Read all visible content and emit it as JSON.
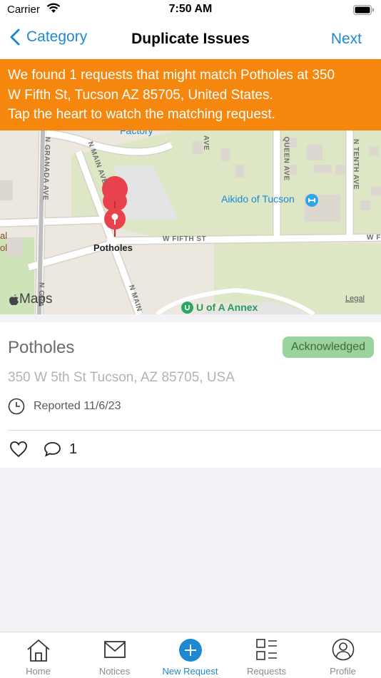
{
  "status_bar": {
    "carrier": "Carrier",
    "time": "7:50 AM"
  },
  "nav": {
    "back_label": "Category",
    "title": "Duplicate Issues",
    "next_label": "Next"
  },
  "banner": {
    "lines": [
      "We found 1 requests that might match Potholes at 350",
      "W Fifth St, Tucson AZ 85705, United States.",
      "Tap the heart to watch the matching request."
    ]
  },
  "map": {
    "streets": {
      "granada": "N GRANADA AVE",
      "granada_lower": "N GRA",
      "main": "N MAIN AVE",
      "main_lower": "N MAIN",
      "queen": "QUEEN AVE",
      "tenth": "N TENTH AVE",
      "fifth": "W FIFTH ST",
      "fifth_right": "W F",
      "ave_small": "AVE"
    },
    "pois": {
      "factory": "Factory",
      "aikido": "Aikido of Tucson",
      "annex": "U of A Annex",
      "left_a": "al",
      "left_b": "ol"
    },
    "pin_label": "Potholes",
    "maps_brand": "Maps",
    "legal": "Legal"
  },
  "issue": {
    "title": "Potholes",
    "status": "Acknowledged",
    "address": "350 W 5th St Tucson, AZ 85705, USA",
    "reported": "Reported 11/6/23",
    "comment_count": "1"
  },
  "tabs": [
    {
      "label": "Home",
      "icon": "home-icon"
    },
    {
      "label": "Notices",
      "icon": "mail-icon"
    },
    {
      "label": "New Request",
      "icon": "plus-circle-icon",
      "active": true
    },
    {
      "label": "Requests",
      "icon": "list-icon"
    },
    {
      "label": "Profile",
      "icon": "person-icon"
    }
  ],
  "colors": {
    "accent": "#1e88d0",
    "banner": "#f5870f",
    "pin": "#e8434c",
    "badge_bg": "#9ad39c"
  }
}
